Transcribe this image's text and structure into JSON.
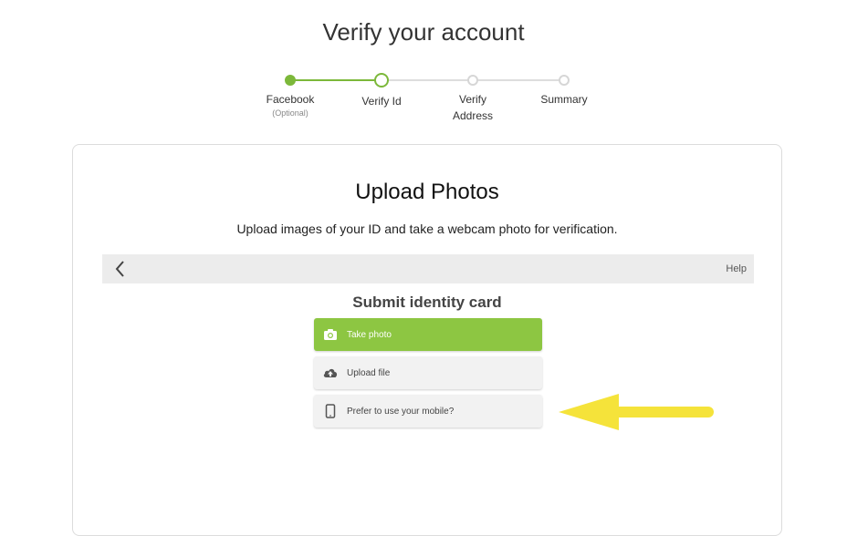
{
  "page": {
    "title": "Verify your account"
  },
  "stepper": {
    "steps": [
      {
        "label": "Facebook",
        "sublabel": "(Optional)",
        "state": "complete"
      },
      {
        "label": "Verify Id",
        "sublabel": "",
        "state": "current"
      },
      {
        "label": "Verify\nAddress",
        "sublabel": "",
        "state": "pending"
      },
      {
        "label": "Summary",
        "sublabel": "",
        "state": "pending"
      }
    ]
  },
  "card": {
    "title": "Upload Photos",
    "description": "Upload images of your ID and take a webcam photo for verification.",
    "toolbar": {
      "back_icon": "chevron-left-icon",
      "help_label": "Help"
    },
    "submit_title": "Submit identity card",
    "options": [
      {
        "label": "Take photo",
        "icon": "camera-icon"
      },
      {
        "label": "Upload file",
        "icon": "cloud-upload-icon"
      },
      {
        "label": "Prefer to use your mobile?",
        "icon": "mobile-phone-icon"
      }
    ]
  },
  "colors": {
    "accent": "#8dc642",
    "stepper_green": "#7cb83a",
    "annotation_arrow": "#f5e33a"
  }
}
